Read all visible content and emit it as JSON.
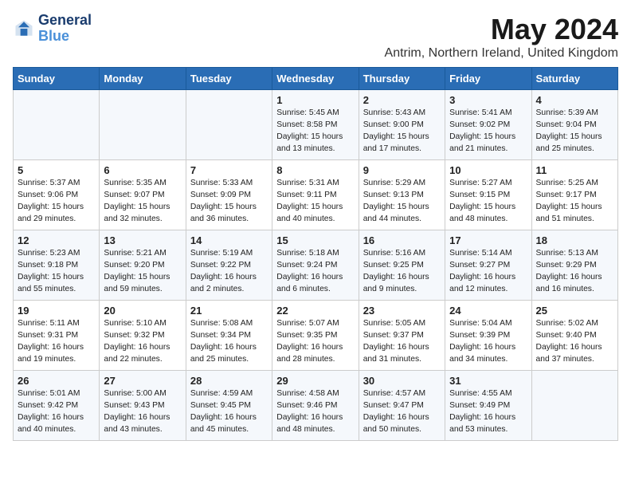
{
  "logo": {
    "line1": "General",
    "line2": "Blue"
  },
  "title": "May 2024",
  "location": "Antrim, Northern Ireland, United Kingdom",
  "days_of_week": [
    "Sunday",
    "Monday",
    "Tuesday",
    "Wednesday",
    "Thursday",
    "Friday",
    "Saturday"
  ],
  "weeks": [
    [
      {
        "day": "",
        "info": ""
      },
      {
        "day": "",
        "info": ""
      },
      {
        "day": "",
        "info": ""
      },
      {
        "day": "1",
        "info": "Sunrise: 5:45 AM\nSunset: 8:58 PM\nDaylight: 15 hours\nand 13 minutes."
      },
      {
        "day": "2",
        "info": "Sunrise: 5:43 AM\nSunset: 9:00 PM\nDaylight: 15 hours\nand 17 minutes."
      },
      {
        "day": "3",
        "info": "Sunrise: 5:41 AM\nSunset: 9:02 PM\nDaylight: 15 hours\nand 21 minutes."
      },
      {
        "day": "4",
        "info": "Sunrise: 5:39 AM\nSunset: 9:04 PM\nDaylight: 15 hours\nand 25 minutes."
      }
    ],
    [
      {
        "day": "5",
        "info": "Sunrise: 5:37 AM\nSunset: 9:06 PM\nDaylight: 15 hours\nand 29 minutes."
      },
      {
        "day": "6",
        "info": "Sunrise: 5:35 AM\nSunset: 9:07 PM\nDaylight: 15 hours\nand 32 minutes."
      },
      {
        "day": "7",
        "info": "Sunrise: 5:33 AM\nSunset: 9:09 PM\nDaylight: 15 hours\nand 36 minutes."
      },
      {
        "day": "8",
        "info": "Sunrise: 5:31 AM\nSunset: 9:11 PM\nDaylight: 15 hours\nand 40 minutes."
      },
      {
        "day": "9",
        "info": "Sunrise: 5:29 AM\nSunset: 9:13 PM\nDaylight: 15 hours\nand 44 minutes."
      },
      {
        "day": "10",
        "info": "Sunrise: 5:27 AM\nSunset: 9:15 PM\nDaylight: 15 hours\nand 48 minutes."
      },
      {
        "day": "11",
        "info": "Sunrise: 5:25 AM\nSunset: 9:17 PM\nDaylight: 15 hours\nand 51 minutes."
      }
    ],
    [
      {
        "day": "12",
        "info": "Sunrise: 5:23 AM\nSunset: 9:18 PM\nDaylight: 15 hours\nand 55 minutes."
      },
      {
        "day": "13",
        "info": "Sunrise: 5:21 AM\nSunset: 9:20 PM\nDaylight: 15 hours\nand 59 minutes."
      },
      {
        "day": "14",
        "info": "Sunrise: 5:19 AM\nSunset: 9:22 PM\nDaylight: 16 hours\nand 2 minutes."
      },
      {
        "day": "15",
        "info": "Sunrise: 5:18 AM\nSunset: 9:24 PM\nDaylight: 16 hours\nand 6 minutes."
      },
      {
        "day": "16",
        "info": "Sunrise: 5:16 AM\nSunset: 9:25 PM\nDaylight: 16 hours\nand 9 minutes."
      },
      {
        "day": "17",
        "info": "Sunrise: 5:14 AM\nSunset: 9:27 PM\nDaylight: 16 hours\nand 12 minutes."
      },
      {
        "day": "18",
        "info": "Sunrise: 5:13 AM\nSunset: 9:29 PM\nDaylight: 16 hours\nand 16 minutes."
      }
    ],
    [
      {
        "day": "19",
        "info": "Sunrise: 5:11 AM\nSunset: 9:31 PM\nDaylight: 16 hours\nand 19 minutes."
      },
      {
        "day": "20",
        "info": "Sunrise: 5:10 AM\nSunset: 9:32 PM\nDaylight: 16 hours\nand 22 minutes."
      },
      {
        "day": "21",
        "info": "Sunrise: 5:08 AM\nSunset: 9:34 PM\nDaylight: 16 hours\nand 25 minutes."
      },
      {
        "day": "22",
        "info": "Sunrise: 5:07 AM\nSunset: 9:35 PM\nDaylight: 16 hours\nand 28 minutes."
      },
      {
        "day": "23",
        "info": "Sunrise: 5:05 AM\nSunset: 9:37 PM\nDaylight: 16 hours\nand 31 minutes."
      },
      {
        "day": "24",
        "info": "Sunrise: 5:04 AM\nSunset: 9:39 PM\nDaylight: 16 hours\nand 34 minutes."
      },
      {
        "day": "25",
        "info": "Sunrise: 5:02 AM\nSunset: 9:40 PM\nDaylight: 16 hours\nand 37 minutes."
      }
    ],
    [
      {
        "day": "26",
        "info": "Sunrise: 5:01 AM\nSunset: 9:42 PM\nDaylight: 16 hours\nand 40 minutes."
      },
      {
        "day": "27",
        "info": "Sunrise: 5:00 AM\nSunset: 9:43 PM\nDaylight: 16 hours\nand 43 minutes."
      },
      {
        "day": "28",
        "info": "Sunrise: 4:59 AM\nSunset: 9:45 PM\nDaylight: 16 hours\nand 45 minutes."
      },
      {
        "day": "29",
        "info": "Sunrise: 4:58 AM\nSunset: 9:46 PM\nDaylight: 16 hours\nand 48 minutes."
      },
      {
        "day": "30",
        "info": "Sunrise: 4:57 AM\nSunset: 9:47 PM\nDaylight: 16 hours\nand 50 minutes."
      },
      {
        "day": "31",
        "info": "Sunrise: 4:55 AM\nSunset: 9:49 PM\nDaylight: 16 hours\nand 53 minutes."
      },
      {
        "day": "",
        "info": ""
      }
    ]
  ]
}
